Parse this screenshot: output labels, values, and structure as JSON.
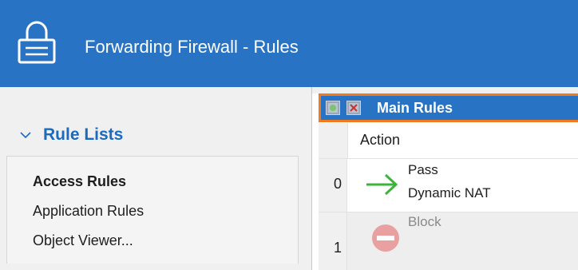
{
  "window": {
    "title": "Forwarding Firewall - Rules",
    "title_icon": "lock-icon",
    "title_bar_color": "#2873c4"
  },
  "sidebar": {
    "section_title": "Rule Lists",
    "section_expanded": true,
    "items": [
      {
        "label": "Access Rules",
        "active": true
      },
      {
        "label": "Application Rules",
        "active": false
      },
      {
        "label": "Object Viewer...",
        "active": false
      }
    ]
  },
  "rules_panel": {
    "title": "Main Rules",
    "toolbar_icons": [
      "add-rule-icon",
      "delete-rule-icon"
    ],
    "highlight_color": "#f07a1e",
    "columns": [
      "Action"
    ],
    "rows": [
      {
        "index": "0",
        "action": "Pass",
        "detail": "Dynamic NAT",
        "icon": "pass-arrow-icon",
        "icon_color": "#3cb43c"
      },
      {
        "index": "1",
        "action": "Block",
        "detail": "",
        "icon": "block-icon",
        "icon_color": "#e8a0a0",
        "disabled": true
      }
    ]
  }
}
